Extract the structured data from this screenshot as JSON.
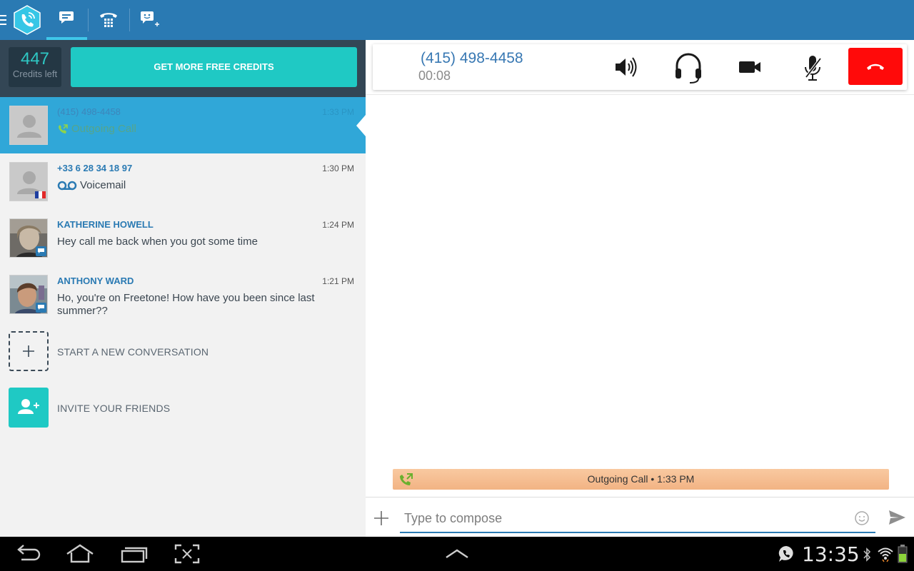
{
  "colors": {
    "brand": "#2a7ab3",
    "accent": "#1fc9c4",
    "selected": "#30a7d8",
    "hangup": "#ff0a0a",
    "call_event": "#f2b384"
  },
  "topbar": {
    "menu_icon": "hamburger-icon",
    "logo_icon": "freetone-logo-icon",
    "tabs": [
      {
        "icon": "chat-bubble-icon",
        "active": true
      },
      {
        "icon": "telephone-keypad-icon",
        "active": false
      },
      {
        "icon": "new-message-icon",
        "active": false
      }
    ]
  },
  "credits": {
    "value": "447",
    "label": "Credits left"
  },
  "free_credits_button": "GET MORE FREE CREDITS",
  "conversations": [
    {
      "name": "(415) 498-4458",
      "time": "1:33 PM",
      "message": "Outgoing Call",
      "type_icon": "outgoing-call-icon",
      "selected": true
    },
    {
      "name": "+33 6 28 34 18 97",
      "time": "1:30 PM",
      "message": "Voicemail",
      "type_icon": "voicemail-icon",
      "badge": "france-flag-icon"
    },
    {
      "name": "KATHERINE HOWELL",
      "time": "1:24 PM",
      "message": "Hey call me back when you got some time",
      "badge": "chat-badge-icon"
    },
    {
      "name": "ANTHONY WARD",
      "time": "1:21 PM",
      "message": "Ho, you're on Freetone! How have you been since last summer??",
      "badge": "chat-badge-icon"
    }
  ],
  "actions": {
    "new_conversation": "START A NEW CONVERSATION",
    "invite_friends": "INVITE YOUR FRIENDS"
  },
  "call": {
    "number": "(415) 498-4458",
    "duration": "00:08",
    "buttons": [
      "speaker-icon",
      "headset-icon",
      "video-camera-icon",
      "mute-microphone-icon",
      "hang-up-icon"
    ]
  },
  "call_event": "Outgoing Call • 1:33 PM",
  "compose": {
    "placeholder": "Type to compose",
    "value": ""
  },
  "status_bar": {
    "time": "13:35"
  },
  "navbar_icons": [
    "back-icon",
    "home-icon",
    "recent-apps-icon",
    "screenshot-icon",
    "up-arrow-icon"
  ],
  "status_icons": [
    "freetone-status-icon",
    "bluetooth-icon",
    "wifi-icon",
    "battery-icon"
  ]
}
